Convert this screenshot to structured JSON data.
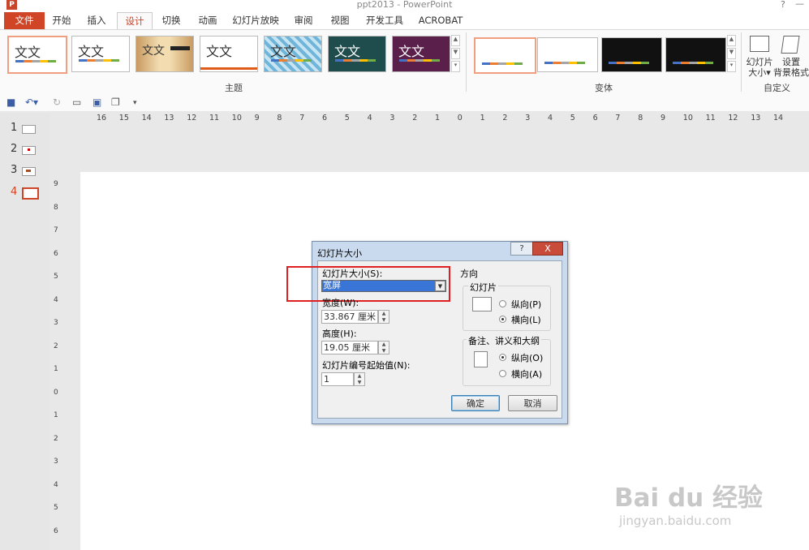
{
  "window": {
    "title": "ppt2013 - PowerPoint",
    "help": "?",
    "minimize": "—",
    "app_icon": "P"
  },
  "tabs": [
    "文件",
    "开始",
    "插入",
    "设计",
    "切换",
    "动画",
    "幻灯片放映",
    "审阅",
    "视图",
    "开发工具",
    "ACROBAT"
  ],
  "themes": {
    "sample_text": "文文",
    "sample_text_alt": "文文",
    "group_label": "主题"
  },
  "variants": {
    "group_label": "变体"
  },
  "customize": {
    "slide_size_label_1": "幻灯片",
    "slide_size_label_2": "大小▾",
    "bg_label_1": "设置",
    "bg_label_2": "背景格式",
    "group_label": "自定义"
  },
  "ruler_h": [
    "16",
    "15",
    "14",
    "13",
    "12",
    "11",
    "10",
    "9",
    "8",
    "7",
    "6",
    "5",
    "4",
    "3",
    "2",
    "1",
    "0",
    "1",
    "2",
    "3",
    "4",
    "5",
    "6",
    "7",
    "8",
    "9",
    "10",
    "11",
    "12",
    "13",
    "14"
  ],
  "ruler_v": [
    "9",
    "8",
    "7",
    "6",
    "5",
    "4",
    "3",
    "2",
    "1",
    "0",
    "1",
    "2",
    "3",
    "4",
    "5",
    "6"
  ],
  "slides": [
    "1",
    "2",
    "3",
    "4"
  ],
  "dialog": {
    "title": "幻灯片大小",
    "help": "?",
    "close": "X",
    "size_label": "幻灯片大小(S):",
    "size_value": "宽屏",
    "width_label": "宽度(W):",
    "width_value": "33.867 厘米",
    "height_label": "高度(H):",
    "height_value": "19.05 厘米",
    "start_label": "幻灯片编号起始值(N):",
    "start_value": "1",
    "orientation_label": "方向",
    "slides_group": "幻灯片",
    "portrait": "纵向(P)",
    "landscape": "横向(L)",
    "notes_group": "备注、讲义和大纲",
    "notes_portrait": "纵向(O)",
    "notes_landscape": "横向(A)",
    "ok": "确定",
    "cancel": "取消"
  },
  "watermark": {
    "main": "Bai du 经验",
    "sub": "jingyan.baidu.com"
  },
  "colors": {
    "accent": "#d04525",
    "selection": "#3875d7",
    "highlight": "#e02020"
  }
}
